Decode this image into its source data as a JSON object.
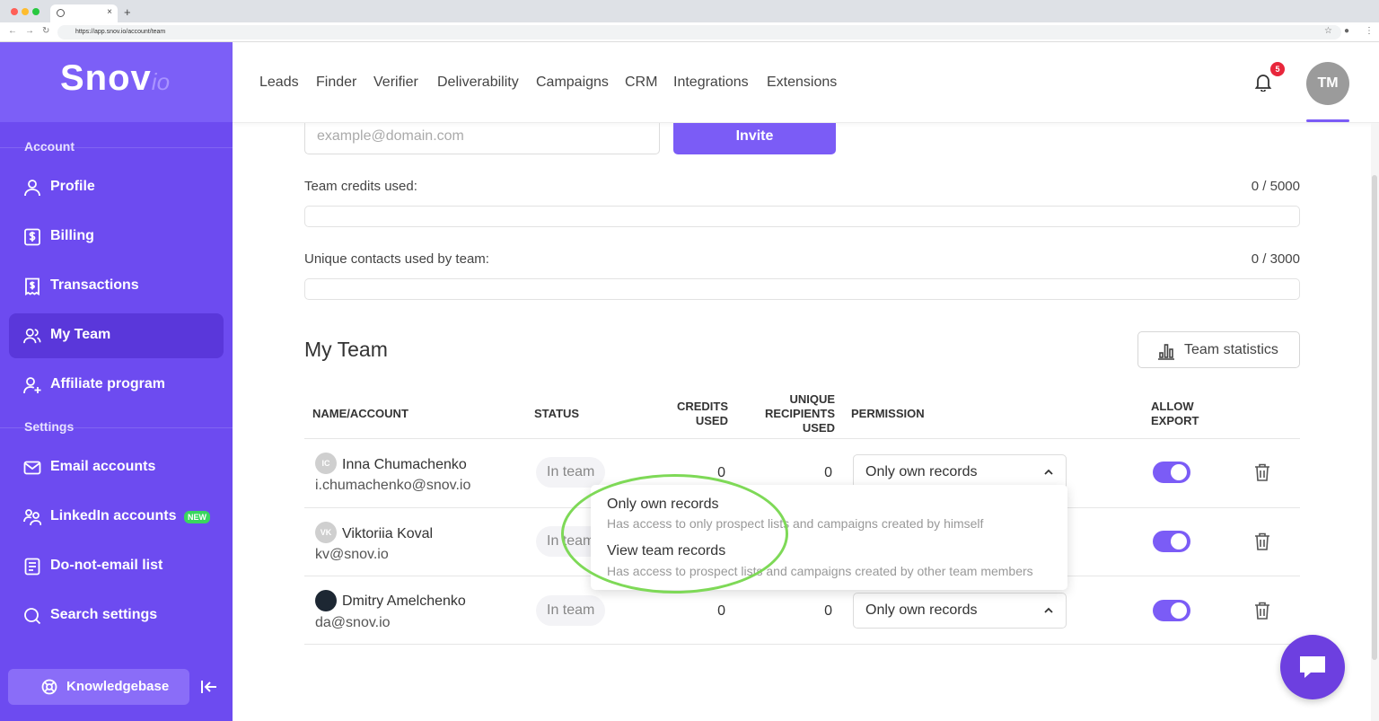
{
  "browser": {
    "url": "https://app.snov.io/account/team"
  },
  "logo": {
    "main": "Snov",
    "suffix": "io"
  },
  "sidebar": {
    "sections": [
      "Account",
      "Settings"
    ],
    "items": [
      {
        "label": "Profile",
        "icon": "user-icon"
      },
      {
        "label": "Billing",
        "icon": "dollar-card-icon"
      },
      {
        "label": "Transactions",
        "icon": "receipt-icon"
      },
      {
        "label": "My Team",
        "icon": "team-icon",
        "active": true
      },
      {
        "label": "Affiliate program",
        "icon": "user-plus-icon"
      },
      {
        "label": "Email accounts",
        "icon": "envelope-icon"
      },
      {
        "label": "LinkedIn accounts",
        "icon": "people-icon",
        "badge": "NEW"
      },
      {
        "label": "Do-not-email list",
        "icon": "list-document-icon"
      },
      {
        "label": "Search settings",
        "icon": "search-icon"
      }
    ],
    "knowledgebase": "Knowledgebase"
  },
  "topnav": {
    "items": [
      "Leads",
      "Finder",
      "Verifier",
      "Deliverability",
      "Campaigns",
      "CRM",
      "Integrations",
      "Extensions"
    ],
    "notifications": "5",
    "avatar": "TM"
  },
  "invite": {
    "placeholder": "example@domain.com",
    "button": "Invite"
  },
  "credits": {
    "label": "Team credits used:",
    "value": "0 / 5000",
    "fraction": 0
  },
  "contacts": {
    "label": "Unique contacts used by team:",
    "value": "0 / 3000",
    "fraction": 0
  },
  "team": {
    "title": "My Team",
    "stats_button": "Team statistics",
    "headers": {
      "name": "NAME/ACCOUNT",
      "status": "STATUS",
      "credits": "CREDITS USED",
      "unique": "UNIQUE RECIPIENTS USED",
      "permission": "PERMISSION",
      "export": "ALLOW EXPORT"
    },
    "members": [
      {
        "initials": "IC",
        "name": "Inna Chumachenko",
        "email": "i.chumachenko@snov.io",
        "status": "In team",
        "credits": "0",
        "unique": "0",
        "permission": "Only own records",
        "export": true
      },
      {
        "initials": "VK",
        "name": "Viktoriia Koval",
        "email": "kv@snov.io",
        "status": "In team",
        "export": true
      },
      {
        "initials": "",
        "name": "Dmitry Amelchenko",
        "email": "da@snov.io",
        "status": "In team",
        "credits": "0",
        "unique": "0",
        "permission": "Only own records",
        "export": true
      }
    ]
  },
  "dropdown": {
    "options": [
      {
        "title": "Only own records",
        "desc": "Has access to only prospect lists and campaigns created by himself"
      },
      {
        "title": "View team records",
        "desc": "Has access to prospect lists and campaigns created by other team members"
      }
    ]
  },
  "colors": {
    "brand": "#7b5cf6",
    "sidebar": "#6d4bf0",
    "highlight": "#7ed957",
    "notification": "#e8263b"
  }
}
